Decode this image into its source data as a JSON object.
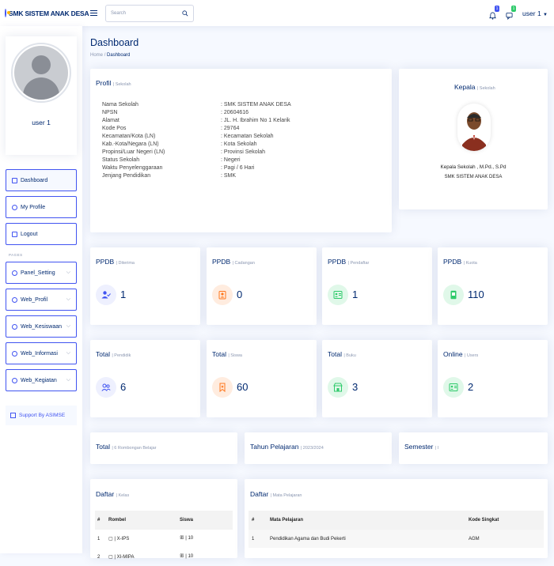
{
  "header": {
    "app_title": "SMK SISTEM ANAK DESA",
    "search_placeholder": "Search",
    "notifications_count": "1",
    "messages_count": "1",
    "user_label": "user 1"
  },
  "sidebar": {
    "profile_name": "user 1",
    "items": [
      {
        "label": "Dashboard"
      },
      {
        "label": "My Profile"
      },
      {
        "label": "Logout"
      }
    ],
    "section_heading": "PAGES",
    "groups": [
      {
        "label": "Panel_Setting"
      },
      {
        "label": "Web_Profil"
      },
      {
        "label": "Web_Kesiswaan"
      },
      {
        "label": "Web_Informasi"
      },
      {
        "label": "Web_Kegiatan"
      }
    ],
    "support_label": "Support By ASIMSE"
  },
  "page": {
    "title": "Dashboard",
    "breadcrumb_home": "Home",
    "breadcrumb_sep": "/",
    "breadcrumb_current": "Dashboard"
  },
  "profil": {
    "title": "Profil",
    "subtitle": "| Sekolah",
    "rows": [
      {
        "k": "Nama Sekolah",
        "v": ": SMK SISTEM ANAK DESA"
      },
      {
        "k": "NPSN",
        "v": ": 20604616"
      },
      {
        "k": "Alamat",
        "v": ": JL. H. Ibrahim No 1 Kelarik"
      },
      {
        "k": "Kode Pos",
        "v": ": 29764"
      },
      {
        "k": "Kecamatan/Kota (LN)",
        "v": ": Kecamatan Sekolah"
      },
      {
        "k": "Kab.-Kota/Negara (LN)",
        "v": ": Kota Sekolah"
      },
      {
        "k": "Propinsi/Luar Negeri (LN)",
        "v": ": Provinsi Sekolah"
      },
      {
        "k": "Status Sekolah",
        "v": ": Negeri"
      },
      {
        "k": "Waktu Penyelenggaraan",
        "v": ": Pagi / 6 Hari"
      },
      {
        "k": "Jenjang Pendidikan",
        "v": ": SMK"
      }
    ]
  },
  "kepala": {
    "title": "Kepala",
    "subtitle": "| Sekolah",
    "name": "Kepala Sekolah , M.Pd., S.Pd",
    "school": "SMK SISTEM ANAK DESA"
  },
  "stats": [
    {
      "title": "PPDB",
      "subtitle": "| Diterima",
      "value": "1",
      "icon": "user-check-icon",
      "color": "#eef0fe",
      "icon_color": "#4154f1"
    },
    {
      "title": "PPDB",
      "subtitle": "| Cadangan",
      "value": "0",
      "icon": "person-badge-icon",
      "color": "#ffecdf",
      "icon_color": "#ff771d"
    },
    {
      "title": "PPDB",
      "subtitle": "| Pendaftar",
      "value": "1",
      "icon": "person-lines-icon",
      "color": "#e0f8e9",
      "icon_color": "#2eca6a"
    },
    {
      "title": "PPDB",
      "subtitle": "| Kuota",
      "value": "110",
      "icon": "phone-portrait-icon",
      "color": "#e0f8e9",
      "icon_color": "#2eca6a"
    },
    {
      "title": "Total",
      "subtitle": "| Pendidik",
      "value": "6",
      "icon": "people-icon",
      "color": "#eef0fe",
      "icon_color": "#4154f1"
    },
    {
      "title": "Total",
      "subtitle": "| Siswa",
      "value": "60",
      "icon": "bookmark-icon",
      "color": "#ffecdf",
      "icon_color": "#ff771d"
    },
    {
      "title": "Total",
      "subtitle": "| Buku",
      "value": "3",
      "icon": "shop-icon",
      "color": "#e0f8e9",
      "icon_color": "#2eca6a"
    },
    {
      "title": "Online",
      "subtitle": "| Users",
      "value": "2",
      "icon": "person-lines-icon",
      "color": "#e0f8e9",
      "icon_color": "#2eca6a"
    }
  ],
  "info": [
    {
      "title": "Total",
      "subtitle": "| 6 Rombongan Belajar"
    },
    {
      "title": "Tahun Pelajaran",
      "subtitle": "| 2023/2024"
    },
    {
      "title": "Semester",
      "subtitle": "| I"
    }
  ],
  "daftar_kelas": {
    "title": "Daftar",
    "subtitle": "| Kelas",
    "headers": [
      "#",
      "Rombel",
      "Siswa"
    ],
    "rows": [
      [
        "1",
        "X-IPS",
        "10"
      ],
      [
        "2",
        "XI-MIPA",
        "10"
      ]
    ]
  },
  "daftar_mapel": {
    "title": "Daftar",
    "subtitle": "| Mata Pelajaran",
    "headers": [
      "#",
      "Mata Pelajaran",
      "Kode Singkat"
    ],
    "rows": [
      [
        "1",
        "Pendidikan Agama dan Budi Pekerti",
        "AGM"
      ]
    ]
  }
}
